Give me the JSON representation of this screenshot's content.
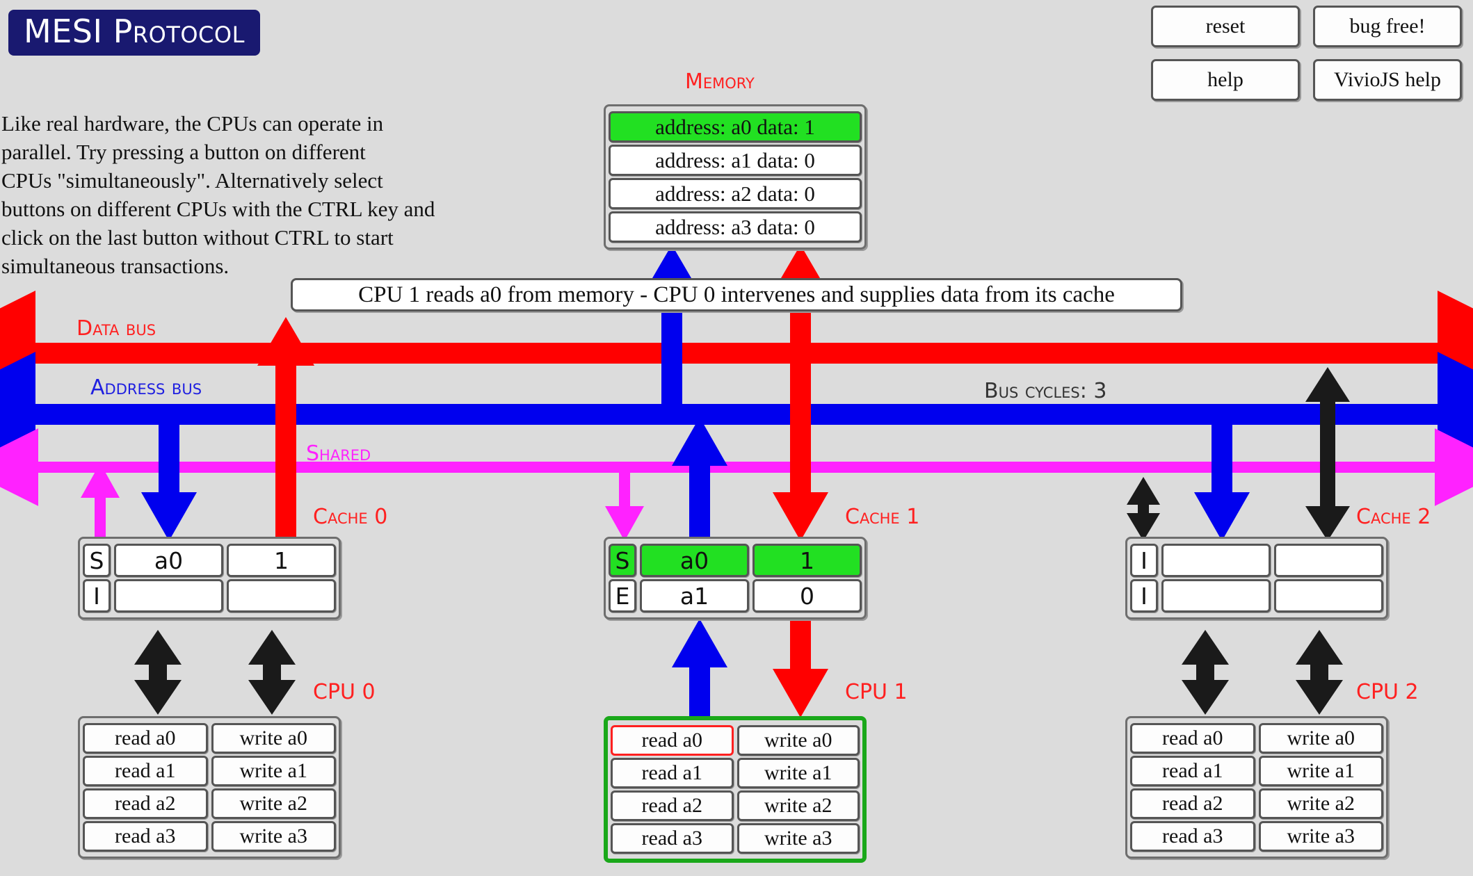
{
  "title": "MESI Protocol",
  "description": "Like real hardware, the CPUs can operate in\nparallel. Try pressing a button on different\nCPUs \"simultaneously\". Alternatively select\nbuttons on different CPUs with the CTRL key and\nclick on the last button without CTRL to start\nsimultaneous transactions.",
  "toolbar": {
    "reset_label": "reset",
    "bug_free_label": "bug free!",
    "help_label": "help",
    "vivio_help_label": "VivioJS help"
  },
  "memory": {
    "label": "Memory",
    "rows": [
      {
        "text": "address: a0 data: 1",
        "highlighted": true
      },
      {
        "text": "address: a1 data: 0",
        "highlighted": false
      },
      {
        "text": "address: a2 data: 0",
        "highlighted": false
      },
      {
        "text": "address: a3 data: 0",
        "highlighted": false
      }
    ]
  },
  "status_message": "CPU 1 reads a0 from memory - CPU 0 intervenes and supplies data from its cache",
  "buses": {
    "data_bus_label": "Data bus",
    "address_bus_label": "Address bus",
    "shared_label": "Shared",
    "bus_cycles_label": "Bus cycles: 3"
  },
  "colors": {
    "data_bus": "#ff0000",
    "address_bus": "#0000ee",
    "shared": "#ff22ff",
    "idle": "#1a1a1a",
    "highlight": "#22e022",
    "title_bg": "#191970",
    "label_red": "#ff2020",
    "active_border": "#1aa81a",
    "selected_border": "#ff2020",
    "page_bg": "#dcdcdc"
  },
  "caches": [
    {
      "label": "Cache 0",
      "rows": [
        {
          "state": "S",
          "tag": "a0",
          "value": "1",
          "highlighted": false
        },
        {
          "state": "I",
          "tag": "",
          "value": "",
          "highlighted": false
        }
      ]
    },
    {
      "label": "Cache 1",
      "rows": [
        {
          "state": "S",
          "tag": "a0",
          "value": "1",
          "highlighted": true
        },
        {
          "state": "E",
          "tag": "a1",
          "value": "0",
          "highlighted": false
        }
      ]
    },
    {
      "label": "Cache 2",
      "rows": [
        {
          "state": "I",
          "tag": "",
          "value": "",
          "highlighted": false
        },
        {
          "state": "I",
          "tag": "",
          "value": "",
          "highlighted": false
        }
      ]
    }
  ],
  "cpus": [
    {
      "label": "CPU 0",
      "active": false,
      "rows": [
        {
          "read": "read a0",
          "write": "write a0",
          "read_selected": false,
          "write_selected": false
        },
        {
          "read": "read a1",
          "write": "write a1",
          "read_selected": false,
          "write_selected": false
        },
        {
          "read": "read a2",
          "write": "write a2",
          "read_selected": false,
          "write_selected": false
        },
        {
          "read": "read a3",
          "write": "write a3",
          "read_selected": false,
          "write_selected": false
        }
      ]
    },
    {
      "label": "CPU 1",
      "active": true,
      "rows": [
        {
          "read": "read a0",
          "write": "write a0",
          "read_selected": true,
          "write_selected": false
        },
        {
          "read": "read a1",
          "write": "write a1",
          "read_selected": false,
          "write_selected": false
        },
        {
          "read": "read a2",
          "write": "write a2",
          "read_selected": false,
          "write_selected": false
        },
        {
          "read": "read a3",
          "write": "write a3",
          "read_selected": false,
          "write_selected": false
        }
      ]
    },
    {
      "label": "CPU 2",
      "active": false,
      "rows": [
        {
          "read": "read a0",
          "write": "write a0",
          "read_selected": false,
          "write_selected": false
        },
        {
          "read": "read a1",
          "write": "write a1",
          "read_selected": false,
          "write_selected": false
        },
        {
          "read": "read a2",
          "write": "write a2",
          "read_selected": false,
          "write_selected": false
        },
        {
          "read": "read a3",
          "write": "write a3",
          "read_selected": false,
          "write_selected": false
        }
      ]
    }
  ]
}
